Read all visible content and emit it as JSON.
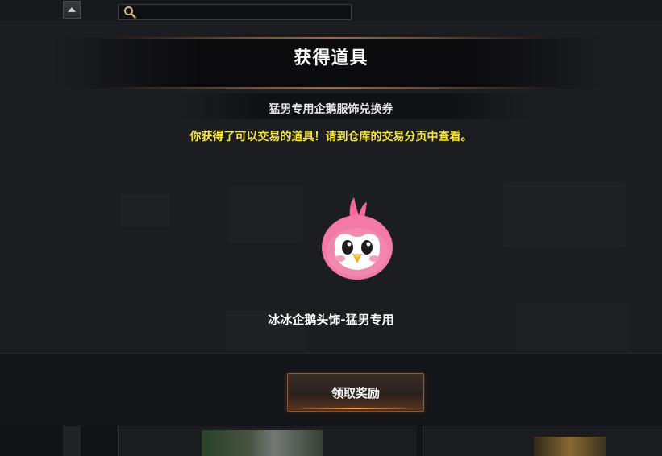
{
  "popup": {
    "title": "获得道具",
    "item_voucher": "猛男专用企鹅服饰兑换券",
    "notice": "你获得了可以交易的道具！请到仓库的交易分页中查看。",
    "item_name": "冰冰企鹅头饰-猛男专用",
    "claim_button": "领取奖励"
  },
  "icons": {
    "search": "search-icon",
    "scroll_up": "triangle-up-icon",
    "item": "pink-penguin-headwear-icon"
  },
  "colors": {
    "title_text": "#ffffff",
    "notice_text": "#f4e34a",
    "button_border": "#8a5a3c",
    "background": "#1c1d21"
  }
}
